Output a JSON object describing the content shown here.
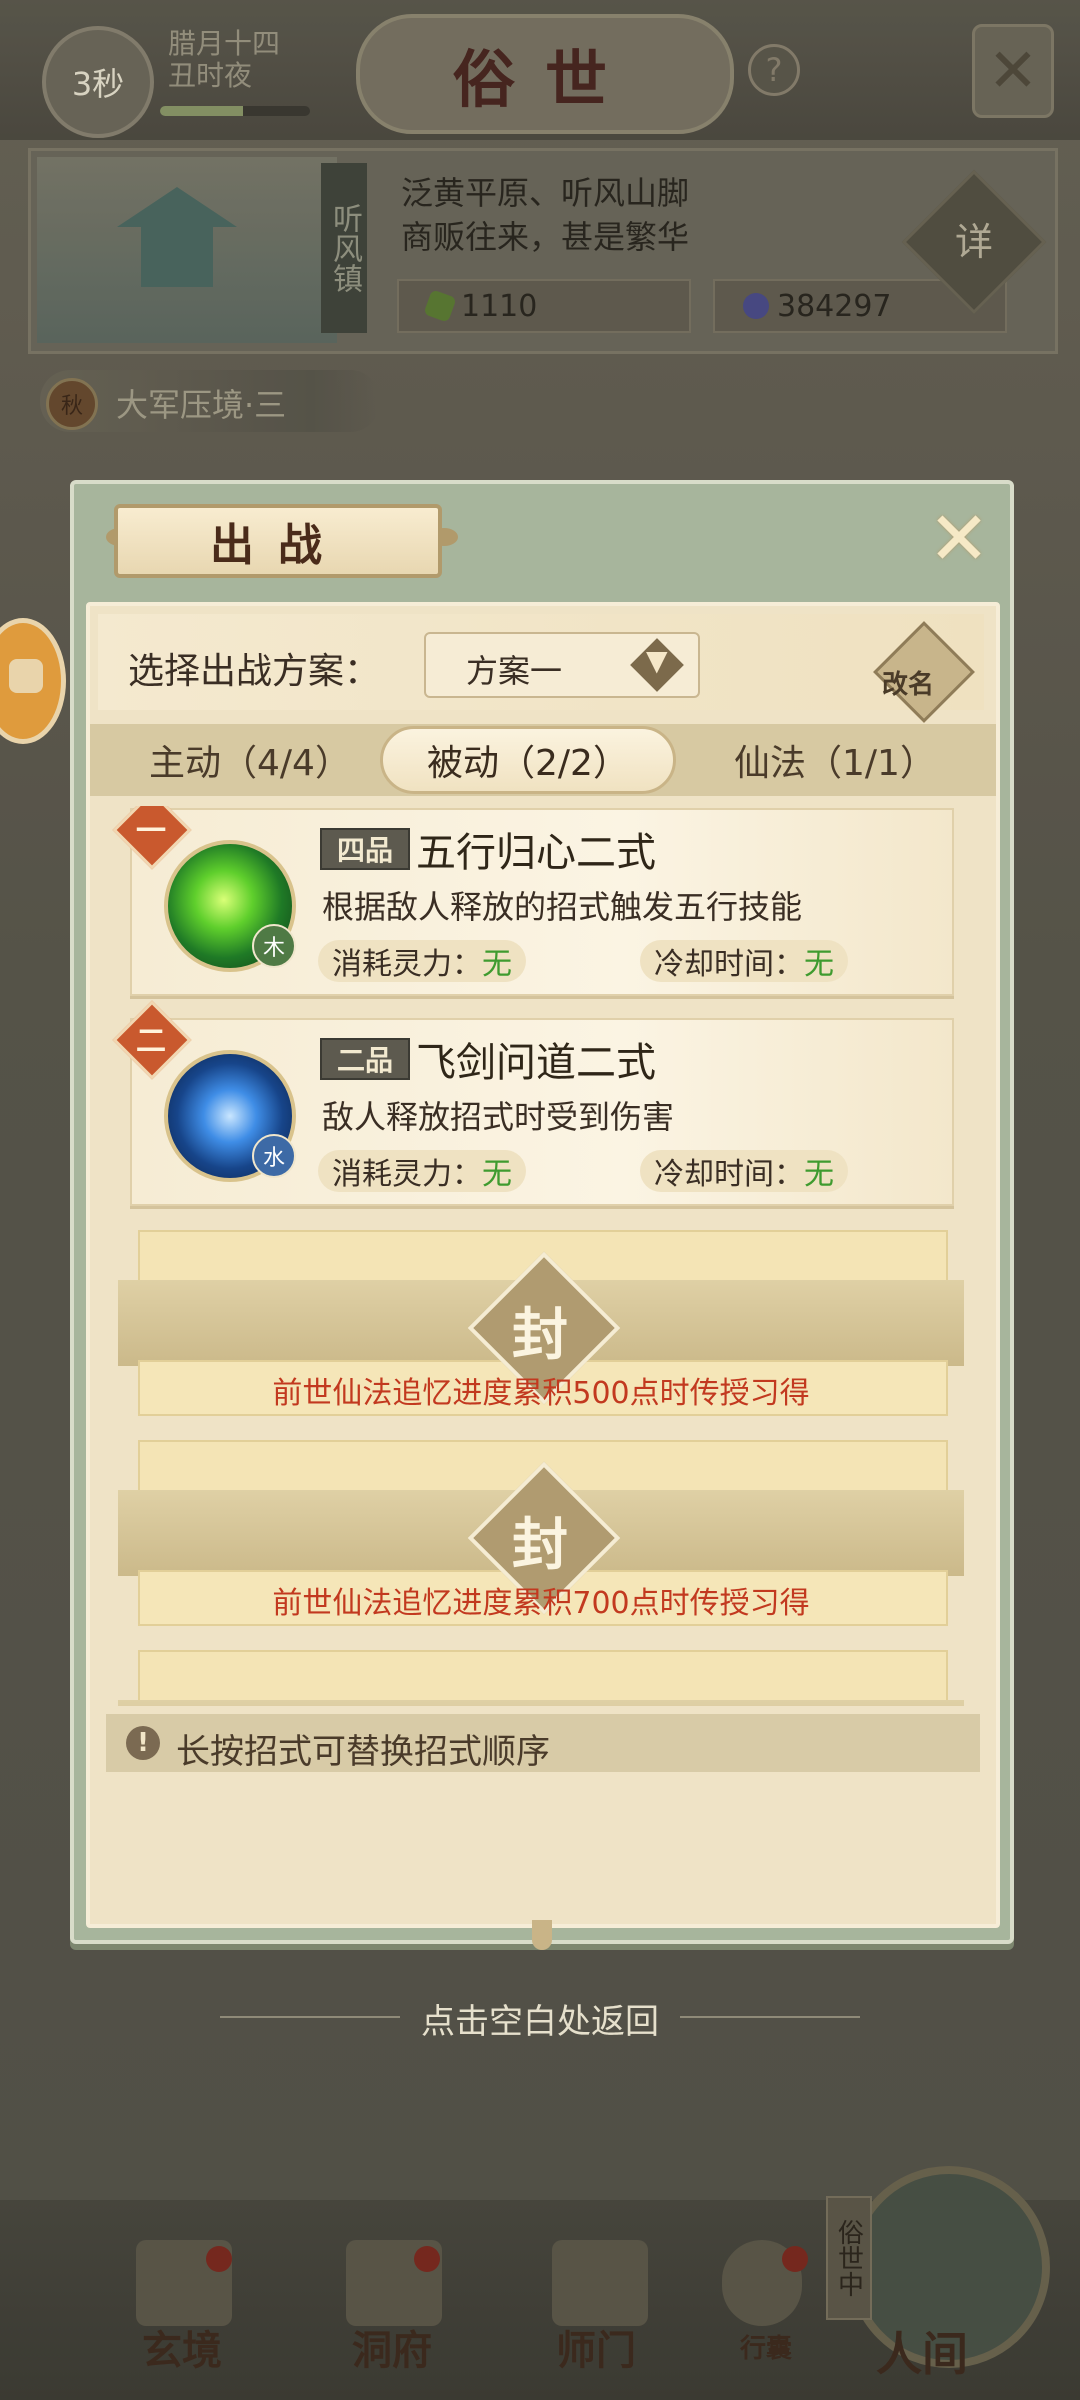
{
  "top": {
    "timer": "3秒",
    "date_line1": "腊月十四",
    "date_line2": "丑时夜",
    "time_progress_percent": 55,
    "title": "俗世",
    "help_label": "?"
  },
  "location": {
    "name": "听风镇",
    "desc_line1": "泛黄平原、听风山脚",
    "desc_line2": "商贩往来，甚是繁华",
    "resource_1": "1110",
    "resource_2": "384297",
    "detail_label": "详"
  },
  "quest": {
    "badge": "秋",
    "text": "大军压境·三"
  },
  "dialog": {
    "title": "出战",
    "scheme_label": "选择出战方案：",
    "scheme_value": "方案一",
    "rename_label": "改名",
    "tabs": [
      {
        "label": "主动（4/4）"
      },
      {
        "label": "被动（2/2）"
      },
      {
        "label": "仙法（1/1）"
      }
    ],
    "active_tab": "被动（2/2）",
    "skills": [
      {
        "order": "一",
        "grade": "四品",
        "name": "五行归心二式",
        "desc": "根据敌人释放的招式触发五行技能",
        "element": "木",
        "cost_label": "消耗灵力：",
        "cost_value": "无",
        "cd_label": "冷却时间：",
        "cd_value": "无"
      },
      {
        "order": "二",
        "grade": "二品",
        "name": "飞剑问道二式",
        "desc": "敌人释放招式时受到伤害",
        "element": "水",
        "cost_label": "消耗灵力：",
        "cost_value": "无",
        "cd_label": "冷却时间：",
        "cd_value": "无"
      }
    ],
    "sealed_slots": [
      {
        "seal": "封",
        "desc": "前世仙法追忆进度累积500点时传授习得"
      },
      {
        "seal": "封",
        "desc": "前世仙法追忆进度累积700点时传授习得"
      }
    ],
    "hint": "长按招式可替换招式顺序"
  },
  "back_hint": "点击空白处返回",
  "nav": {
    "items": [
      {
        "label": "玄境"
      },
      {
        "label": "洞府"
      },
      {
        "label": "师门"
      },
      {
        "label": "行囊"
      },
      {
        "label": "人间"
      }
    ],
    "world_tag": "俗世中"
  },
  "colors": {
    "accent_red": "#c2391f",
    "value_green": "#3f9b2f",
    "dialog_frame": "#a7b59c"
  }
}
